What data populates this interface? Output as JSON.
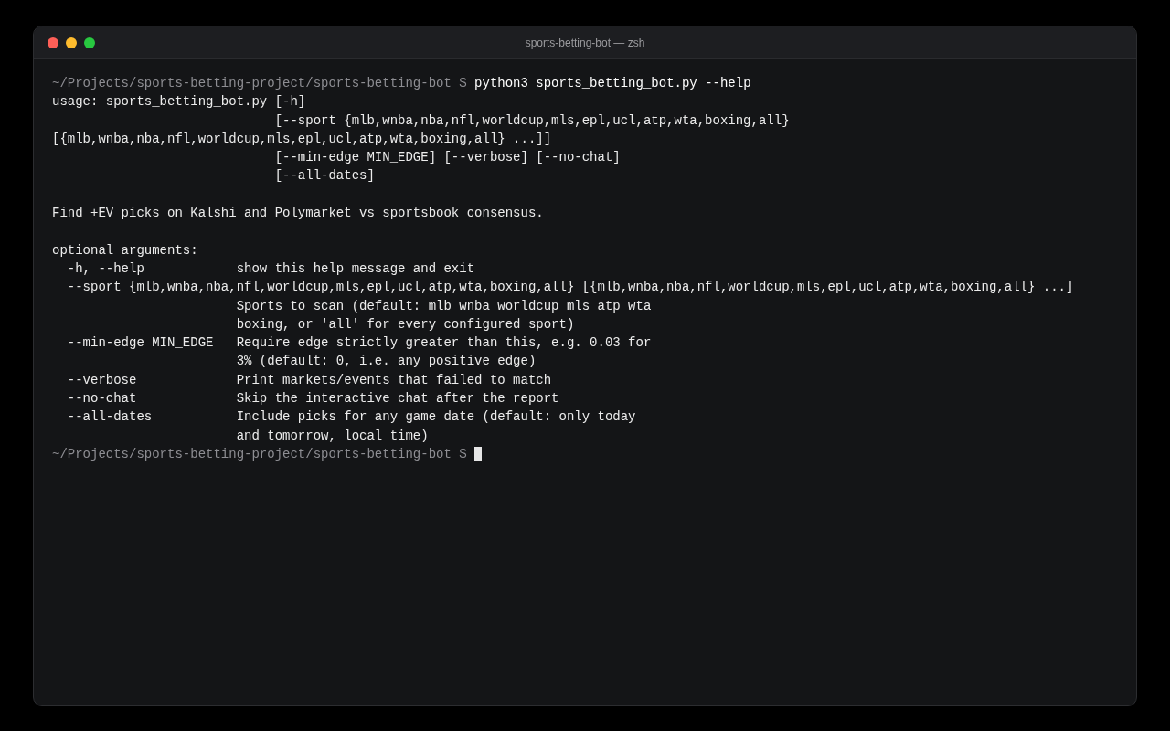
{
  "window": {
    "title": "sports-betting-bot — zsh"
  },
  "lines": [
    {
      "kind": "prompt",
      "prompt": "~/Projects/sports-betting-project/sports-betting-bot $",
      "command": "python3 sports_betting_bot.py --help",
      "cursor": false
    },
    {
      "kind": "output",
      "text": "usage: sports_betting_bot.py [-h]"
    },
    {
      "kind": "output",
      "text": "                             [--sport {mlb,wnba,nba,nfl,worldcup,mls,epl,ucl,atp,wta,boxing,all}"
    },
    {
      "kind": "output",
      "text": "[{mlb,wnba,nba,nfl,worldcup,mls,epl,ucl,atp,wta,boxing,all} ...]]"
    },
    {
      "kind": "output",
      "text": "                             [--min-edge MIN_EDGE] [--verbose] [--no-chat]"
    },
    {
      "kind": "output",
      "text": "                             [--all-dates]"
    },
    {
      "kind": "blank"
    },
    {
      "kind": "output",
      "text": "Find +EV picks on Kalshi and Polymarket vs sportsbook consensus."
    },
    {
      "kind": "blank"
    },
    {
      "kind": "output",
      "text": "optional arguments:"
    },
    {
      "kind": "output",
      "text": "  -h, --help            show this help message and exit"
    },
    {
      "kind": "output",
      "text": "  --sport {mlb,wnba,nba,nfl,worldcup,mls,epl,ucl,atp,wta,boxing,all} [{mlb,wnba,nba,nfl,worldcup,mls,epl,ucl,atp,wta,boxing,all} ...]"
    },
    {
      "kind": "output",
      "text": "                        Sports to scan (default: mlb wnba worldcup mls atp wta"
    },
    {
      "kind": "output",
      "text": "                        boxing, or 'all' for every configured sport)"
    },
    {
      "kind": "output",
      "text": "  --min-edge MIN_EDGE   Require edge strictly greater than this, e.g. 0.03 for"
    },
    {
      "kind": "output",
      "text": "                        3% (default: 0, i.e. any positive edge)"
    },
    {
      "kind": "output",
      "text": "  --verbose             Print markets/events that failed to match"
    },
    {
      "kind": "output",
      "text": "  --no-chat             Skip the interactive chat after the report"
    },
    {
      "kind": "output",
      "text": "  --all-dates           Include picks for any game date (default: only today"
    },
    {
      "kind": "output",
      "text": "                        and tomorrow, local time)"
    },
    {
      "kind": "prompt",
      "prompt": "~/Projects/sports-betting-project/sports-betting-bot $",
      "cursor": true
    }
  ]
}
